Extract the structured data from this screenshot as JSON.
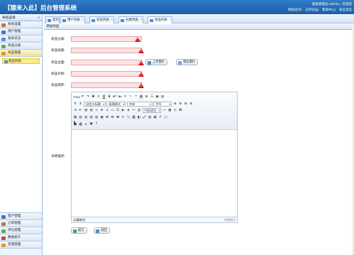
{
  "header": {
    "title": "【猿来入此】后台管理系统",
    "user_line": "超级管理员:admin，欢迎您",
    "links": [
      "网站首页",
      "支持论坛",
      "帮助中心",
      "安全退出"
    ]
  },
  "sidebar": {
    "title": "导航菜单",
    "collapse": "«",
    "top_items": [
      {
        "label": "系统设置",
        "icon": "gear-icon",
        "color": "#c8732a"
      },
      {
        "label": "用户管理",
        "icon": "users-icon",
        "color": "#3a76c2"
      },
      {
        "label": "系统日志",
        "icon": "log-icon",
        "color": "#5b8fcf"
      },
      {
        "label": "商品分类",
        "icon": "category-icon",
        "color": "#6aa84f"
      }
    ],
    "active_item": {
      "label": "商品管理",
      "icon": "goods-icon",
      "color": "#d9a21b",
      "chevron": "˄"
    },
    "sub_items": [
      {
        "label": "商品列表",
        "icon": "list-icon"
      }
    ],
    "bottom_items": [
      {
        "label": "客户管理",
        "icon": "customer-icon",
        "color": "#3a76c2"
      },
      {
        "label": "订单管理",
        "icon": "order-icon",
        "color": "#c8732a"
      },
      {
        "label": "评论管理",
        "icon": "comment-icon",
        "color": "#6aa84f"
      },
      {
        "label": "数据统计",
        "icon": "stats-icon",
        "color": "#cc4444"
      },
      {
        "label": "充值管理",
        "icon": "recharge-icon",
        "color": "#d9a21b"
      }
    ]
  },
  "tabs": [
    {
      "label": "首页",
      "closable": false
    },
    {
      "label": "用户列表",
      "closable": true
    },
    {
      "label": "日志列表",
      "closable": true
    },
    {
      "label": "分类列表",
      "closable": true
    },
    {
      "label": "商品列表",
      "closable": true
    }
  ],
  "form": {
    "heading": "添加商品",
    "fields": {
      "category_label": "商品分类:",
      "title_label": "商品标题:",
      "image_label": "商品主图:",
      "price_label": "商品价格:",
      "stock_label": "商品库存:",
      "detail_label": "详情描述:"
    },
    "upload_button": "上传图片",
    "preview_button": "预览图片",
    "submit_button": "提交",
    "reset_button": "返回"
  },
  "editor": {
    "dropdowns": {
      "custom_title": "自定义标题",
      "paragraph": "段落格式",
      "font": "字体",
      "size": "字号",
      "code_lang": "代码语言"
    },
    "source_label": "HTML",
    "status_left": "元素路径:",
    "status_right": "字数统计"
  },
  "colors": {
    "header": "#1d5ea7",
    "active_nav": "#f5de93",
    "required_bg": "#fbe3e4",
    "warn": "#dd1111"
  }
}
